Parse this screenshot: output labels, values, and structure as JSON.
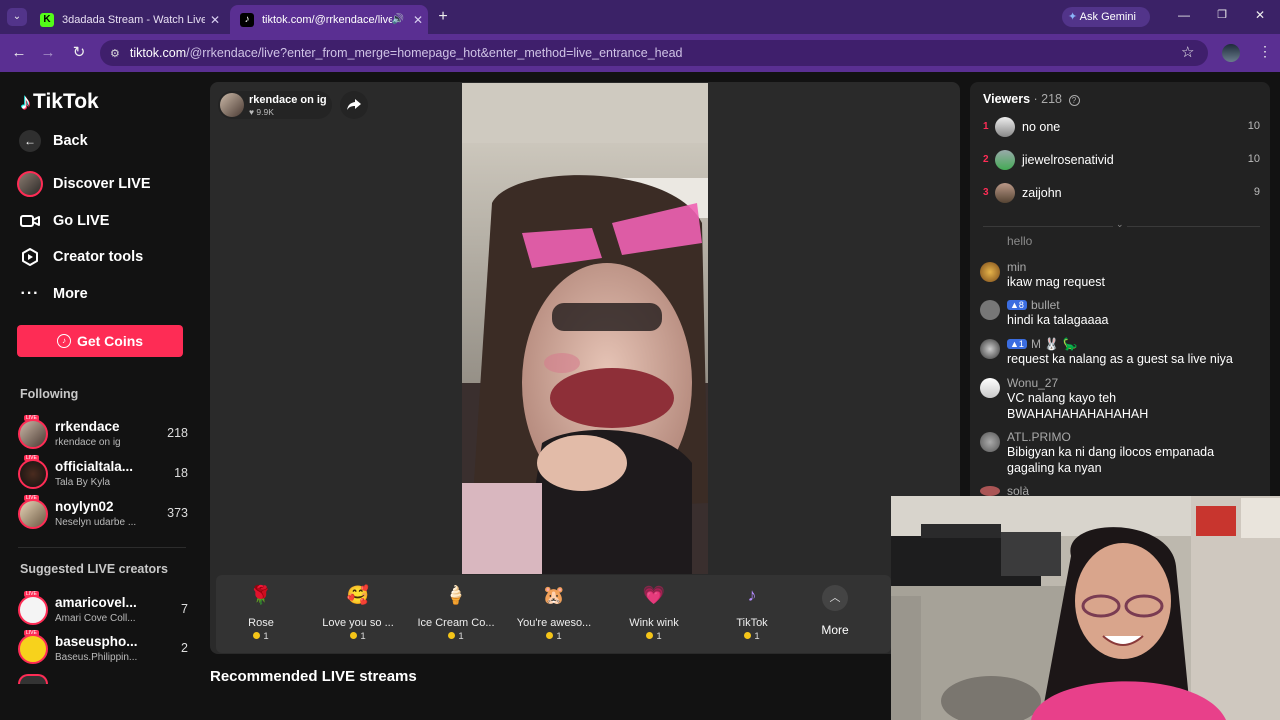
{
  "browser": {
    "tabs": [
      {
        "title": "3dadada Stream - Watch Live o",
        "active": false
      },
      {
        "title": "tiktok.com/@rrkendace/live",
        "active": true
      }
    ],
    "url_host": "tiktok.com",
    "url_path": "/@rrkendace/live?enter_from_merge=homepage_hot&enter_method=live_entrance_head",
    "ask_gemini": "Ask Gemini"
  },
  "sidebar": {
    "logo": "TikTok",
    "back": "Back",
    "nav": [
      {
        "label": "Discover LIVE",
        "icon": "discover-live-icon"
      },
      {
        "label": "Go LIVE",
        "icon": "video-camera-icon"
      },
      {
        "label": "Creator tools",
        "icon": "creator-tools-icon"
      },
      {
        "label": "More",
        "icon": "more-dots-icon"
      }
    ],
    "get_coins": "Get Coins",
    "following_title": "Following",
    "following": [
      {
        "name": "rrkendace",
        "sub": "rkendace on ig",
        "count": "218"
      },
      {
        "name": "officialtala...",
        "sub": "Tala By Kyla",
        "count": "18"
      },
      {
        "name": "noylyn02",
        "sub": "Neselyn udarbe ...",
        "count": "373"
      }
    ],
    "suggested_title": "Suggested LIVE creators",
    "suggested": [
      {
        "name": "amaricovel...",
        "sub": "Amari Cove Coll...",
        "count": "7"
      },
      {
        "name": "baseuspho...",
        "sub": "Baseus.Philippin...",
        "count": "2"
      }
    ],
    "live_badge": "LIVE"
  },
  "stream": {
    "host_name": "rkendace on ig",
    "host_likes": "9.9K",
    "gifts": [
      {
        "name": "Rose",
        "price": "1",
        "icon": "🌹"
      },
      {
        "name": "Love you so ...",
        "price": "1",
        "icon": "🥰"
      },
      {
        "name": "Ice Cream Co...",
        "price": "1",
        "icon": "🍦"
      },
      {
        "name": "You're aweso...",
        "price": "1",
        "icon": "🐹"
      },
      {
        "name": "Wink wink",
        "price": "1",
        "icon": "💗"
      },
      {
        "name": "TikTok",
        "price": "1",
        "icon": "♪"
      }
    ],
    "more": "More",
    "recommended_title": "Recommended LIVE streams"
  },
  "chat": {
    "viewers_label": "Viewers",
    "viewers_count": "· 218",
    "top_viewers": [
      {
        "rank": "1",
        "name": "no one",
        "score": "10"
      },
      {
        "rank": "2",
        "name": "jiewelrosenativid",
        "score": "10"
      },
      {
        "rank": "3",
        "name": "zaijohn",
        "score": "9"
      }
    ],
    "messages": [
      {
        "user": "hello",
        "text": ""
      },
      {
        "user": "min",
        "text": "ikaw mag request"
      },
      {
        "user": "bullet",
        "badge": "8",
        "text": "hindi ka talagaaaa"
      },
      {
        "user": "M 🐰 🦕",
        "badge": "1",
        "text": "request ka nalang as a guest sa live niya"
      },
      {
        "user": "Wonu_27",
        "text": "VC nalang kayo teh BWAHAHAHAHAHAHAH"
      },
      {
        "user": "ATL.PRIMO",
        "text": "Bibigyan ka ni dang ilocos empanada gagaling ka nyan"
      },
      {
        "user": "solà",
        "text": ""
      }
    ]
  }
}
